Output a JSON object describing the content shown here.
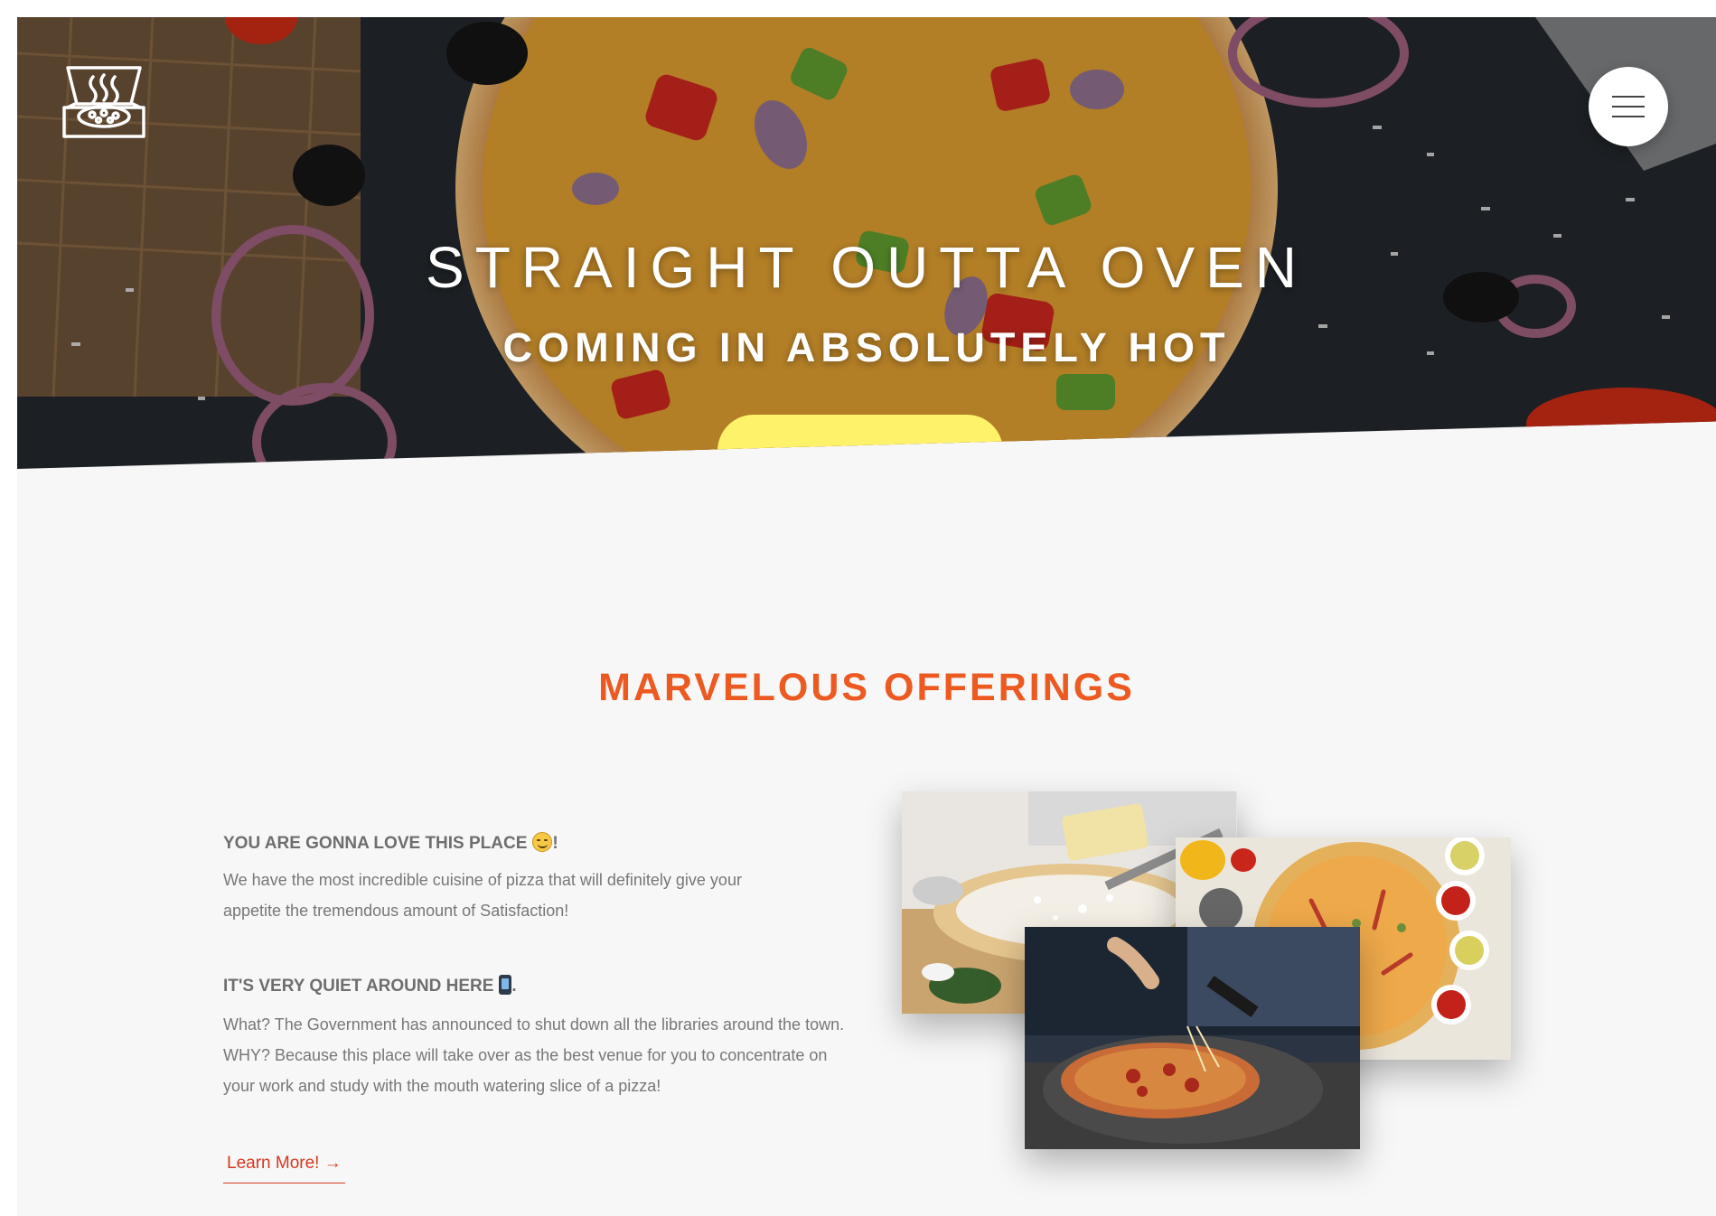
{
  "hero": {
    "title": "STRAIGHT OUTTA OVEN",
    "subtitle": "COMING IN ABSOLUTELY HOT",
    "cta_color": "#fff26b",
    "logo_icon": "pizza-box-icon",
    "menu_icon": "hamburger-menu-icon"
  },
  "offerings": {
    "title": "MARVELOUS OFFERINGS",
    "title_color": "#ec5a22",
    "heading_1": "YOU ARE GONNA LOVE THIS PLACE",
    "heading_1_suffix": "!",
    "heading_1_emoji": "yum-face-emoji",
    "paragraph_1": "We have the most incredible cuisine of pizza that will definitely give your appetite the tremendous amount of Satisfaction!",
    "heading_2": "IT'S VERY QUIET AROUND HERE",
    "heading_2_suffix": ".",
    "heading_2_emoji": "mobile-phone-off-emoji",
    "paragraph_2": "What? The Government has announced to shut down all the libraries around the town. WHY? Because this place will take over as the best venue for you to concentrate on your work and study with the mouth watering slice of a pizza!",
    "link_label": "Learn More! →",
    "link_color": "#d6381f",
    "photos": [
      "grating-cheese-photo",
      "pizza-with-sauces-photo",
      "pizza-stretch-photo"
    ]
  }
}
